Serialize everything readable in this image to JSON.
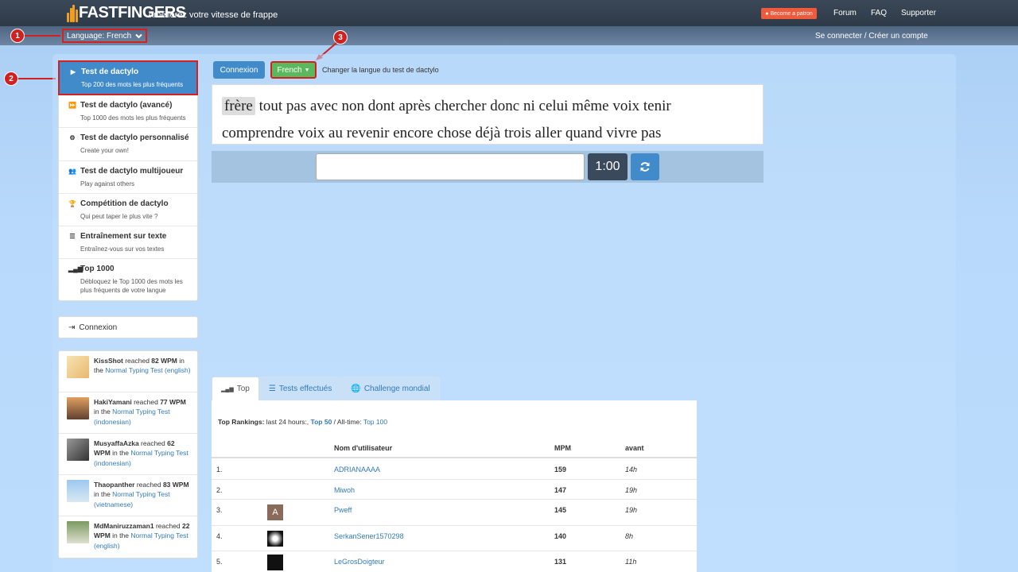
{
  "header": {
    "logo_text": "FASTFINGERS",
    "tagline": "Améliorez votre vitesse de frappe",
    "patron_label": "Become a patron",
    "nav": [
      "Forum",
      "FAQ",
      "Supporter"
    ],
    "language_label": "Language: French",
    "login_label": "Se connecter / Créer un compte"
  },
  "markers": [
    "1",
    "2",
    "3"
  ],
  "sidebar": {
    "items": [
      {
        "title": "Test de dactylo",
        "sub": "Top 200 des mots les plus fréquents",
        "icon": "play-icon"
      },
      {
        "title": "Test de dactylo (avancé)",
        "sub": "Top 1000 des mots les plus fréquents",
        "icon": "fast-forward-icon"
      },
      {
        "title": "Test de dactylo personnalisé",
        "sub": "Create your own!",
        "icon": "cogs-icon"
      },
      {
        "title": "Test de dactylo multijoueur",
        "sub": "Play against others",
        "icon": "users-icon"
      },
      {
        "title": "Compétition de dactylo",
        "sub": "Qui peut taper le plus vite ?",
        "icon": "trophy-icon"
      },
      {
        "title": "Entraînement sur texte",
        "sub": "Entraînez-vous sur vos textes",
        "icon": "text-icon"
      },
      {
        "title": "Top 1000",
        "sub": "Débloquez le Top 1000 des mots les plus fréquents de votre langue",
        "icon": "signal-icon"
      }
    ],
    "connexion_label": "Connexion"
  },
  "feed": [
    {
      "user": "KissShot",
      "mid": " reached ",
      "wpm": "82 WPM",
      "in": " in the ",
      "test": "Normal Typing Test (english)"
    },
    {
      "user": "HakiYamani",
      "mid": " reached ",
      "wpm": "77 WPM",
      "in": " in the ",
      "test": "Normal Typing Test (indonesian)"
    },
    {
      "user": "MusyaffaAzka",
      "mid": " reached ",
      "wpm": "62 WPM",
      "in": " in the ",
      "test": "Normal Typing Test (indonesian)"
    },
    {
      "user": "Thaopanther",
      "mid": " reached ",
      "wpm": "83 WPM",
      "in": " in the ",
      "test": "Normal Typing Test (vietnamese)"
    },
    {
      "user": "MdManiruzzaman1",
      "mid": " reached ",
      "wpm": "22 WPM",
      "in": " in the ",
      "test": "Normal Typing Test (english)"
    }
  ],
  "test": {
    "connexion_button": "Connexion",
    "language_button": "French",
    "change_lang_text": "Changer la langue du test de dactylo",
    "current_word": "frère",
    "words_line1_rest": " tout pas avec non dont après chercher donc ni celui même voix tenir",
    "words_line2": "comprendre voix au revenir encore chose déjà trois aller quand vivre pas",
    "input_value": "",
    "timer": "1:00"
  },
  "tabs": [
    {
      "label": "Top",
      "icon": "signal-icon"
    },
    {
      "label": "Tests effectués",
      "icon": "list-icon"
    },
    {
      "label": "Challenge mondial",
      "icon": "globe-icon"
    }
  ],
  "rankings": {
    "label": "Top Rankings:",
    "last24": " last 24 hours:, ",
    "top50": "Top 50",
    "alltime": " / All-time: ",
    "top100": "Top 100",
    "columns": [
      "Nom d'utilisateur",
      "MPM",
      "avant"
    ],
    "rows": [
      {
        "rank": "1.",
        "user": "ADRIANAAAA",
        "mpm": "159",
        "ago": "14h",
        "avatar": ""
      },
      {
        "rank": "2.",
        "user": "Miwoh",
        "mpm": "147",
        "ago": "19h",
        "avatar": ""
      },
      {
        "rank": "3.",
        "user": "Pweff",
        "mpm": "145",
        "ago": "19h",
        "avatar": "A"
      },
      {
        "rank": "4.",
        "user": "SerkanSener1570298",
        "mpm": "140",
        "ago": "8h",
        "avatar": ""
      },
      {
        "rank": "5.",
        "user": "LeGrosDoigteur",
        "mpm": "131",
        "ago": "11h",
        "avatar": ""
      }
    ]
  }
}
